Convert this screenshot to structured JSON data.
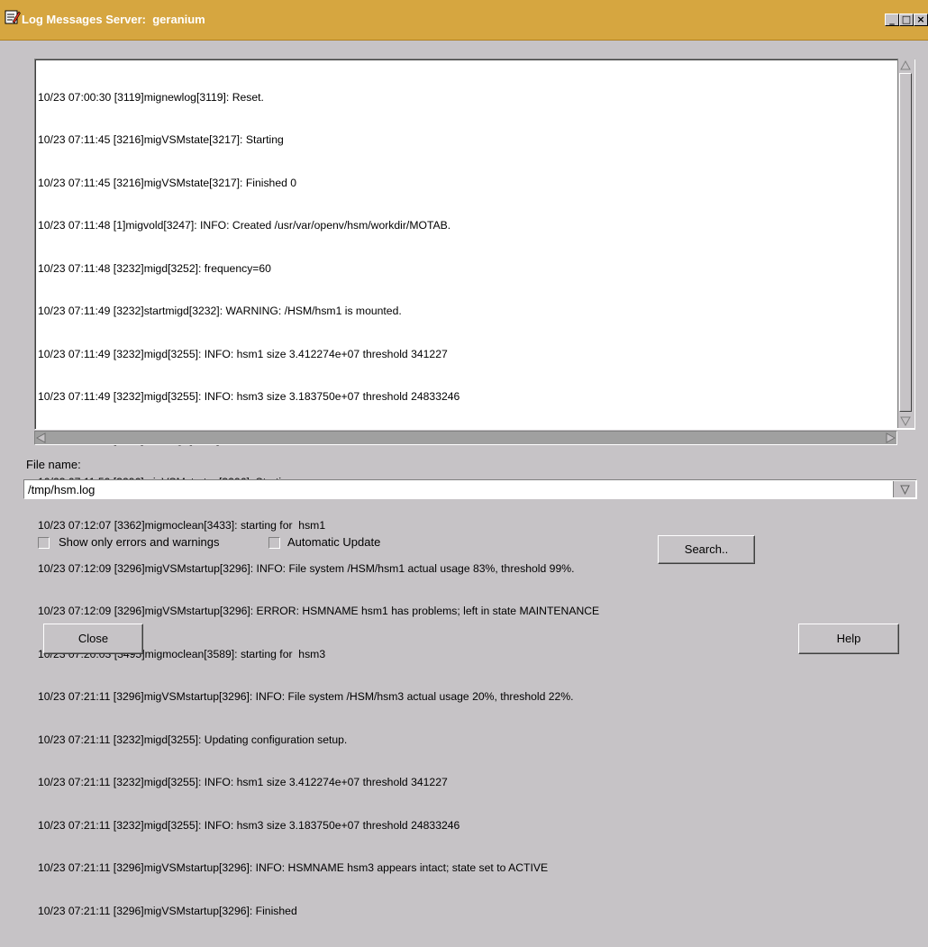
{
  "window": {
    "title": "Log Messages Server:  geranium",
    "controls": {
      "minimize": "_",
      "maximize": "□",
      "close": "×"
    }
  },
  "log": {
    "lines": [
      "10/23 07:00:30 [3119]mignewlog[3119]: Reset.",
      "10/23 07:11:45 [3216]migVSMstate[3217]: Starting",
      "10/23 07:11:45 [3216]migVSMstate[3217]: Finished 0",
      "10/23 07:11:48 [1]migvold[3247]: INFO: Created /usr/var/openv/hsm/workdir/MOTAB.",
      "10/23 07:11:48 [3232]migd[3252]: frequency=60",
      "10/23 07:11:49 [3232]startmigd[3232]: WARNING: /HSM/hsm1 is mounted.",
      "10/23 07:11:49 [3232]migd[3255]: INFO: hsm1 size 3.412274e+07 threshold 341227",
      "10/23 07:11:49 [3232]migd[3255]: INFO: hsm3 size 3.183750e+07 threshold 24833246",
      "10/23 07:11:49 [3232]startmigd[3232]: WARNING: /HSM/hsm3 is mounted.",
      "10/23 07:11:50 [3296]migVSMstartup[3296]: Starting",
      "10/23 07:12:07 [3362]migmoclean[3433]: starting for  hsm1",
      "10/23 07:12:09 [3296]migVSMstartup[3296]: INFO: File system /HSM/hsm1 actual usage 83%, threshold 99%.",
      "10/23 07:12:09 [3296]migVSMstartup[3296]: ERROR: HSMNAME hsm1 has problems; left in state MAINTENANCE",
      "10/23 07:20:03 [3495]migmoclean[3589]: starting for  hsm3",
      "10/23 07:21:11 [3296]migVSMstartup[3296]: INFO: File system /HSM/hsm3 actual usage 20%, threshold 22%.",
      "10/23 07:21:11 [3232]migd[3255]: Updating configuration setup.",
      "10/23 07:21:11 [3232]migd[3255]: INFO: hsm1 size 3.412274e+07 threshold 341227",
      "10/23 07:21:11 [3232]migd[3255]: INFO: hsm3 size 3.183750e+07 threshold 24833246",
      "10/23 07:21:11 [3296]migVSMstartup[3296]: INFO: HSMNAME hsm3 appears intact; state set to ACTIVE",
      "10/23 07:21:11 [3296]migVSMstartup[3296]: Finished"
    ]
  },
  "file": {
    "label": "File name:",
    "value": "/tmp/hsm.log"
  },
  "options": {
    "show_errors_label": "Show only errors and warnings",
    "show_errors_checked": false,
    "auto_update_label": "Automatic Update",
    "auto_update_checked": false
  },
  "buttons": {
    "search": "Search..",
    "close": "Close",
    "help": "Help"
  },
  "colors": {
    "titlebar": "#d6a640",
    "window": "#c6c3c6",
    "text_area": "#ffffff"
  }
}
